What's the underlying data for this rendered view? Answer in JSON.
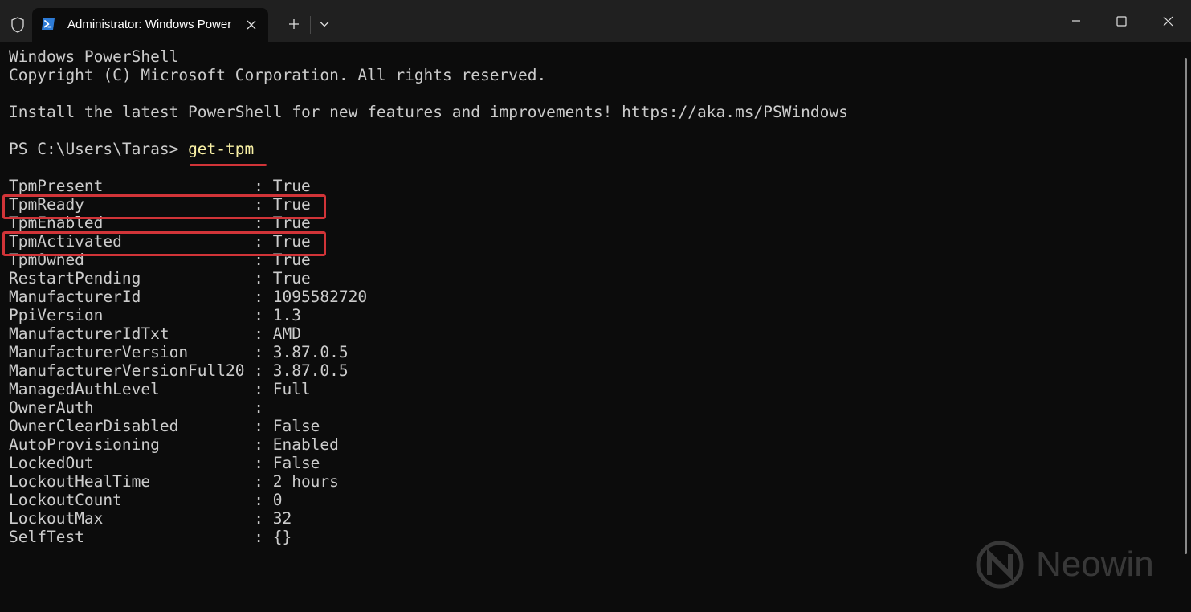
{
  "titlebar": {
    "tab_title": "Administrator: Windows PowerShell",
    "icons": {
      "shield": "shield-icon",
      "tab": "powershell-icon",
      "close_tab": "close-icon",
      "new_tab": "plus-icon",
      "dropdown": "chevron-down-icon",
      "minimize": "minimize-icon",
      "maximize": "maximize-icon",
      "close_window": "close-icon"
    }
  },
  "terminal": {
    "header": [
      "Windows PowerShell",
      "Copyright (C) Microsoft Corporation. All rights reserved.",
      "",
      "Install the latest PowerShell for new features and improvements! https://aka.ms/PSWindows",
      ""
    ],
    "prompt": "PS C:\\Users\\Taras> ",
    "command": "get-tpm",
    "output": [
      "",
      "TpmPresent                : True",
      "TpmReady                  : True",
      "TpmEnabled                : True",
      "TpmActivated              : True",
      "TpmOwned                  : True",
      "RestartPending            : True",
      "ManufacturerId            : 1095582720",
      "PpiVersion                : 1.3",
      "ManufacturerIdTxt         : AMD",
      "ManufacturerVersion       : 3.87.0.5",
      "ManufacturerVersionFull20 : 3.87.0.5",
      "ManagedAuthLevel          : Full",
      "OwnerAuth                 :",
      "OwnerClearDisabled        : False",
      "AutoProvisioning          : Enabled",
      "LockedOut                 : False",
      "LockoutHealTime           : 2 hours",
      "LockoutCount              : 0",
      "LockoutMax                : 32",
      "SelfTest                  : {}"
    ]
  },
  "watermark": {
    "text": "Neowin"
  },
  "colors": {
    "background": "#0c0c0c",
    "titlebar": "#202020",
    "text": "#cccccc",
    "command": "#f9f1a5",
    "annotation": "#d13438"
  }
}
